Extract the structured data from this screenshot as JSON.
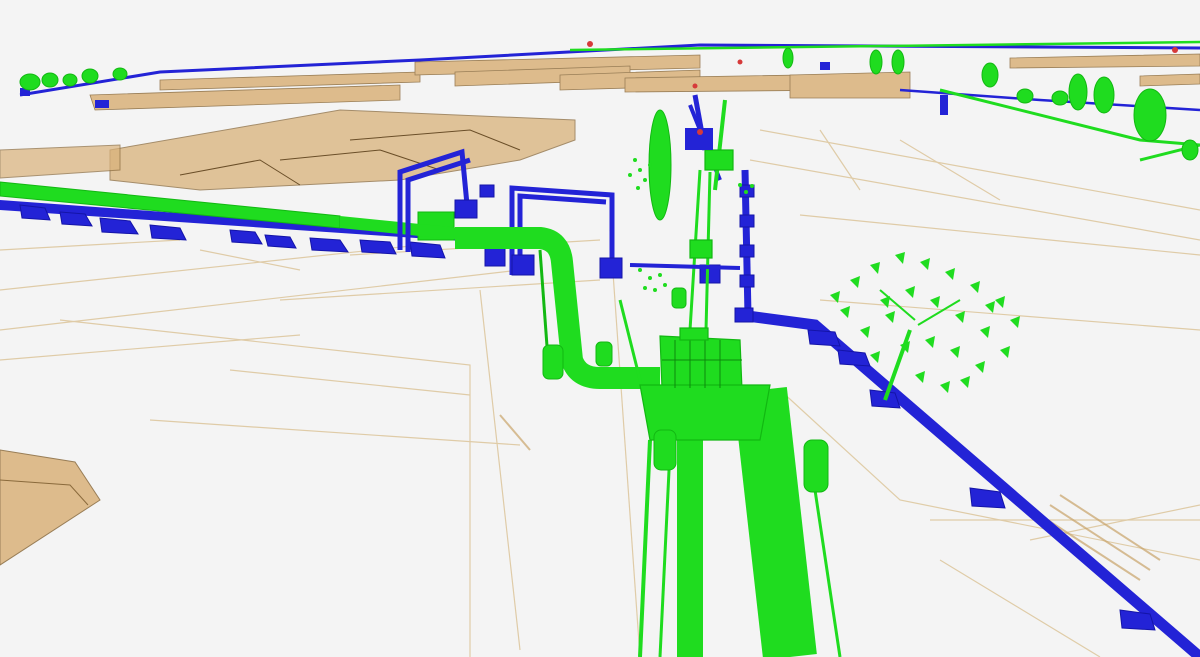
{
  "scene": {
    "description_visible_text": "",
    "colors": {
      "background": "#f4f4f4",
      "green_pipe": "#1fdc1f",
      "green_dark": "#12b812",
      "blue_pipe": "#2323d6",
      "blue_dark": "#1414a8",
      "building_tan": "#d9b27a",
      "building_edge": "#8a6a3c",
      "ground_line": "#dcc59a",
      "tree_green": "#1fdc1f",
      "red_marker": "#d63a3a"
    }
  }
}
